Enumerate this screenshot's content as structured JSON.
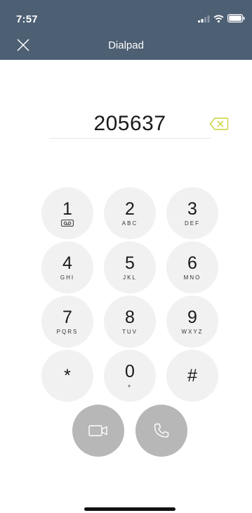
{
  "status_bar": {
    "time": "7:57"
  },
  "header": {
    "title": "Dialpad"
  },
  "dial": {
    "number": "205637"
  },
  "keys": [
    {
      "digit": "1",
      "letters": ""
    },
    {
      "digit": "2",
      "letters": "ABC"
    },
    {
      "digit": "3",
      "letters": "DEF"
    },
    {
      "digit": "4",
      "letters": "GHI"
    },
    {
      "digit": "5",
      "letters": "JKL"
    },
    {
      "digit": "6",
      "letters": "MNO"
    },
    {
      "digit": "7",
      "letters": "PQRS"
    },
    {
      "digit": "8",
      "letters": "TUV"
    },
    {
      "digit": "9",
      "letters": "WXYZ"
    },
    {
      "digit": "*",
      "letters": ""
    },
    {
      "digit": "0",
      "letters": "+"
    },
    {
      "digit": "#",
      "letters": ""
    }
  ],
  "icons": {
    "close": "close-icon",
    "backspace": "backspace-icon",
    "voicemail": "voicemail-icon",
    "video_call": "video-camera-icon",
    "voice_call": "phone-icon"
  },
  "colors": {
    "header_bg": "#4d5f73",
    "key_bg": "#f1f1f1",
    "call_button_bg": "#b7b7b7",
    "backspace_accent": "#c9d33a"
  }
}
